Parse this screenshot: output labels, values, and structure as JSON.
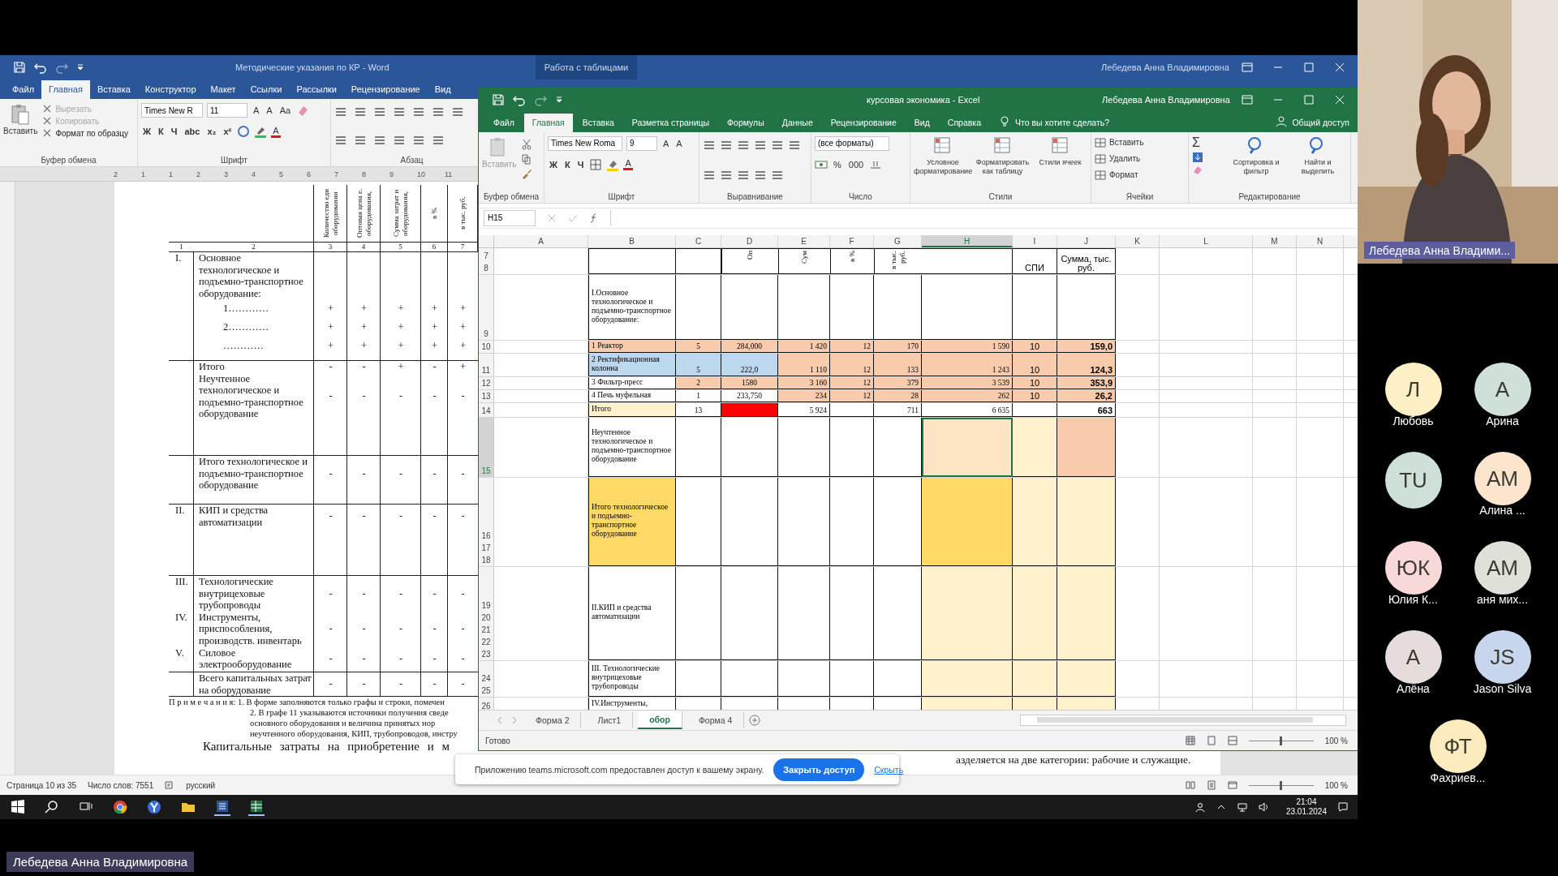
{
  "word": {
    "title": "Методические указания по КР  -  Word",
    "context_tab": "Работа с таблицами",
    "user": "Лебедева Анна Владимировна",
    "tabs": [
      {
        "label": "Файл",
        "selected": false
      },
      {
        "label": "Главная",
        "selected": true
      },
      {
        "label": "Вставка",
        "selected": false
      },
      {
        "label": "Конструктор",
        "selected": false
      },
      {
        "label": "Макет",
        "selected": false
      },
      {
        "label": "Ссылки",
        "selected": false
      },
      {
        "label": "Рассылки",
        "selected": false
      },
      {
        "label": "Рецензирование",
        "selected": false
      },
      {
        "label": "Вид",
        "selected": false
      }
    ],
    "paste": "Вставить",
    "clipboard_items": [
      {
        "label": "Вырезать",
        "disabled": true
      },
      {
        "label": "Копировать",
        "disabled": true
      },
      {
        "label": "Формат по образцу",
        "disabled": false
      }
    ],
    "font_name": "Times New R",
    "font_size": "11",
    "size_tools": [
      "A",
      "A",
      "Aa"
    ],
    "format_letters": [
      "Ж",
      "К",
      "Ч",
      "abc",
      "x₂",
      "x²"
    ],
    "font_color_letter": "A",
    "groups": [
      "Буфер обмена",
      "Шрифт",
      "Абзац"
    ],
    "ruler": [
      "2",
      "1",
      "1",
      "2",
      "3",
      "4",
      "5",
      "6",
      "7",
      "8",
      "9",
      "10",
      "11"
    ],
    "table": {
      "headers": [
        [
          "Количество еди",
          "оборудовании"
        ],
        [
          "Оптовая цена е.",
          "оборудования, "
        ],
        [
          "Сумма затрат н",
          "оборудования, "
        ],
        [
          "в %"
        ],
        [
          "в тыс. руб."
        ]
      ],
      "numbers": [
        "1",
        "2",
        "3",
        "4",
        "5",
        "6",
        "7"
      ],
      "sections": [
        {
          "rows": [
            {
              "num": "I.",
              "label": "Основное технологическое и подъемно-транспортное оборудование:"
            },
            {
              "kind": "item",
              "label": "1…………",
              "marks": [
                "+",
                "+",
                "+",
                "+",
                "+"
              ]
            },
            {
              "kind": "item",
              "label": "2…………",
              "marks": [
                "+",
                "+",
                "+",
                "+",
                "+"
              ]
            },
            {
              "kind": "item",
              "label": "…………",
              "marks": [
                "+",
                "+",
                "+",
                "+",
                "+"
              ]
            }
          ]
        },
        {
          "rows": [
            {
              "label": "Итого",
              "marks": [
                "-",
                "-",
                "+",
                "-",
                "+"
              ]
            },
            {
              "label": "Неучтенное технологическое и подъемно-транспортное оборудование",
              "marks": [
                "-",
                "-",
                "-",
                "-",
                "-"
              ]
            }
          ]
        },
        {
          "rows": [
            {
              "label": "Итого технологическое и подъемно-транспортное оборудование",
              "marks": [
                "-",
                "-",
                "-",
                "-",
                "-"
              ]
            }
          ]
        },
        {
          "rows": [
            {
              "num": "II.",
              "label": "КИП и средства автоматизации",
              "marks": [
                "-",
                "-",
                "-",
                "-",
                "-"
              ]
            }
          ]
        },
        {
          "rows": [
            {
              "num": "III.",
              "label": "Технологические внутрицеховые трубопроводы",
              "marks": [
                "-",
                "-",
                "-",
                "-",
                "-"
              ]
            },
            {
              "num": "IV.",
              "label": "Инструменты, приспособления, производств. инвентарь",
              "marks": [
                "-",
                "-",
                "-",
                "-",
                "-"
              ]
            },
            {
              "num": "V.",
              "label": "Силовое электрооборудование",
              "marks": [
                "-",
                "-",
                "-",
                "-",
                "-"
              ]
            }
          ]
        },
        {
          "rows": [
            {
              "label": "Всего капитальных затрат на оборудование",
              "marks": [
                "-",
                "-",
                "-",
                "-",
                "-"
              ]
            }
          ]
        }
      ]
    },
    "notes": [
      "П р и м е ч а н и я: 1. В форме заполняются только графы и строки, помечен",
      "2. В графе 11 указываются источники получения сведе",
      "основного оборудования и величина принятых нор",
      "неучтенного оборудования, КИП, трубопроводов, инстру"
    ],
    "heading": "Капитальные затраты на приобретение и м",
    "body_line": "азделяется на две категории: рабочие и служащие.",
    "status": {
      "page": "Страница 10 из 35",
      "words": "Число слов: 7551",
      "language": "русский",
      "zoom": "100 %",
      "zoom_slider": {
        "level": 0.5
      }
    }
  },
  "excel": {
    "title": "курсовая экономика  -  Excel",
    "user": "Лебедева Анна Владимировна",
    "tabs": [
      {
        "label": "Файл",
        "selected": false
      },
      {
        "label": "Главная",
        "selected": true
      },
      {
        "label": "Вставка",
        "selected": false
      },
      {
        "label": "Разметка страницы",
        "selected": false
      },
      {
        "label": "Формулы",
        "selected": false
      },
      {
        "label": "Данные",
        "selected": false
      },
      {
        "label": "Рецензирование",
        "selected": false
      },
      {
        "label": "Вид",
        "selected": false
      },
      {
        "label": "Справка",
        "selected": false
      }
    ],
    "tell_me": "Что вы хотите сделать?",
    "share": "Общий доступ",
    "paste": {
      "label": "Вставить",
      "disabled": true
    },
    "font_name": "Times New Roma",
    "font_size": "9",
    "size_tools": [
      "A",
      "A"
    ],
    "format_letters": [
      "Ж",
      "К",
      "Ч"
    ],
    "font_color_letter": "A",
    "number_format": "(все форматы)",
    "number_tools": [
      "%",
      "000"
    ],
    "style_buttons": [
      "Условное форматирование",
      "Форматировать как таблицу",
      "Стили ячеек"
    ],
    "cell_buttons": [
      "Вставить",
      "Удалить",
      "Формат"
    ],
    "sum_symbol": "Σ",
    "edit_buttons": [
      "Сортировка и фильтр",
      "Найти и выделить"
    ],
    "groups": [
      "Буфер обмена",
      "Шрифт",
      "Выравнивание",
      "Число",
      "Стили",
      "Ячейки",
      "Редактирование"
    ],
    "name_box": "H15",
    "columns": [
      {
        "label": "A",
        "selected": false
      },
      {
        "label": "B",
        "selected": false
      },
      {
        "label": "C",
        "selected": false
      },
      {
        "label": "D",
        "selected": false
      },
      {
        "label": "E",
        "selected": false
      },
      {
        "label": "F",
        "selected": false
      },
      {
        "label": "G",
        "selected": false
      },
      {
        "label": "H",
        "selected": true
      },
      {
        "label": "I",
        "selected": false
      },
      {
        "label": "J",
        "selected": false
      },
      {
        "label": "K",
        "selected": false
      },
      {
        "label": "L",
        "selected": false
      },
      {
        "label": "M",
        "selected": false
      },
      {
        "label": "N",
        "selected": false
      }
    ],
    "blocks": [
      {
        "rows": [
          {
            "label": "7",
            "selected": false
          },
          {
            "label": "8",
            "selected": false
          }
        ],
        "cells": [
          {},
          {},
          {
            "text": "Оп",
            "kind": "rotated"
          },
          {
            "text": "Сум",
            "kind": "rotated"
          },
          {
            "text": "в %",
            "kind": "rotated"
          },
          {
            "text": "в тыс. руб.",
            "kind": "rotated"
          },
          {},
          {
            "text": "СПИ"
          },
          {
            "text": "Сумма, тыс. руб."
          }
        ]
      },
      {
        "rows": [
          {
            "label": "9",
            "selected": false
          }
        ],
        "cells": [
          {
            "text": "I.Основное технологическое и подъемно-транспортное оборудование:"
          },
          {},
          {},
          {},
          {},
          {},
          {},
          {},
          {}
        ]
      },
      {
        "rows": [
          {
            "label": "10",
            "selected": false
          }
        ],
        "cells": [
          {
            "text": "1 Реактор",
            "color": "#f8cbad"
          },
          {
            "text": "5",
            "color": "#f8cbad"
          },
          {
            "text": "284,000",
            "color": "#f8cbad"
          },
          {
            "text": "1 420",
            "color": "#f8cbad"
          },
          {
            "text": "12",
            "color": "#f8cbad"
          },
          {
            "text": "170",
            "color": "#f8cbad"
          },
          {
            "text": "1 590",
            "color": "#f8cbad"
          },
          {
            "text": "10",
            "color": "#f8cbad"
          },
          {
            "text": "159,0",
            "color": "#f8cbad"
          }
        ]
      },
      {
        "rows": [
          {
            "label": "11",
            "selected": false
          }
        ],
        "cells": [
          {
            "text": "2 Ректификационная колонна",
            "color": "#bdd7ee"
          },
          {
            "text": "5",
            "color": "#bdd7ee"
          },
          {
            "text": "222,0",
            "color": "#bdd7ee"
          },
          {
            "text": "1 110",
            "color": "#f8cbad"
          },
          {
            "text": "12",
            "color": "#f8cbad"
          },
          {
            "text": "133",
            "color": "#f8cbad"
          },
          {
            "text": "1 243",
            "color": "#f8cbad"
          },
          {
            "text": "10",
            "color": "#f8cbad"
          },
          {
            "text": "124,3",
            "color": "#f8cbad"
          }
        ]
      },
      {
        "rows": [
          {
            "label": "12",
            "selected": false
          }
        ],
        "cells": [
          {
            "text": "3 Фильтр-пресс"
          },
          {
            "text": "2",
            "color": "#f8cbad"
          },
          {
            "text": "1580",
            "color": "#f8cbad"
          },
          {
            "text": "3 160",
            "color": "#f8cbad"
          },
          {
            "text": "12",
            "color": "#f8cbad"
          },
          {
            "text": "379",
            "color": "#f8cbad"
          },
          {
            "text": "3 539",
            "color": "#f8cbad"
          },
          {
            "text": "10",
            "color": "#f8cbad"
          },
          {
            "text": "353,9",
            "color": "#f8cbad"
          }
        ]
      },
      {
        "rows": [
          {
            "label": "13",
            "selected": false
          }
        ],
        "cells": [
          {
            "text": "4 Печь муфельная"
          },
          {
            "text": "1"
          },
          {
            "text": "233,750"
          },
          {
            "text": "234",
            "color": "#f8cbad"
          },
          {
            "text": "12",
            "color": "#f8cbad"
          },
          {
            "text": "28",
            "color": "#f8cbad"
          },
          {
            "text": "262",
            "color": "#f8cbad"
          },
          {
            "text": "10",
            "color": "#f8cbad"
          },
          {
            "text": "26,2",
            "color": "#f8cbad"
          }
        ]
      },
      {
        "rows": [
          {
            "label": "14",
            "selected": false
          }
        ],
        "cells": [
          {
            "text": "Итого",
            "color": "#fff2cc"
          },
          {
            "text": "13"
          },
          {
            "color": "#ff0000"
          },
          {
            "text": "5 924"
          },
          {},
          {
            "text": "711"
          },
          {
            "text": "6 635"
          },
          {},
          {
            "text": "663"
          }
        ]
      },
      {
        "rows": [
          {
            "label": "15",
            "selected": true
          }
        ],
        "cells": [
          {
            "text": "Неучтенное технологическое и подъемно-транспортное оборудование"
          },
          {},
          {},
          {},
          {},
          {},
          {
            "color": "#fce4c4"
          },
          {
            "color": "#fff2cc"
          },
          {
            "color": "#f8cbad"
          }
        ]
      },
      {
        "rows": [
          {
            "label": "16",
            "selected": false
          },
          {
            "label": "17",
            "selected": false
          },
          {
            "label": "18",
            "selected": false
          }
        ],
        "cells": [
          {
            "text": "Итого технологическое и подъемно-транспортное оборудование",
            "color": "#ffd966"
          },
          {},
          {},
          {},
          {},
          {},
          {
            "color": "#ffd966"
          },
          {
            "color": "#fff2cc"
          },
          {
            "color": "#fff2cc"
          }
        ]
      },
      {
        "rows": [
          {
            "label": "19",
            "selected": false
          },
          {
            "label": "20",
            "selected": false
          },
          {
            "label": "21",
            "selected": false
          },
          {
            "label": "22",
            "selected": false
          },
          {
            "label": "23",
            "selected": false
          }
        ],
        "cells": [
          {
            "text": "II.КИП и средства автоматизации"
          },
          {},
          {},
          {},
          {},
          {},
          {
            "color": "#fff2cc"
          },
          {
            "color": "#fff2cc"
          },
          {
            "color": "#fff2cc"
          }
        ]
      },
      {
        "rows": [
          {
            "label": "24",
            "selected": false
          },
          {
            "label": "25",
            "selected": false
          }
        ],
        "cells": [
          {
            "text": "III. Технологические внутрицеховые трубопроводы"
          },
          {},
          {},
          {},
          {},
          {},
          {
            "color": "#fff2cc"
          },
          {
            "color": "#fff2cc"
          },
          {
            "color": "#fff2cc"
          }
        ]
      },
      {
        "rows": [
          {
            "label": "26",
            "selected": false
          }
        ],
        "cells": [
          {
            "text": "IV.Инструменты,"
          },
          {},
          {},
          {},
          {},
          {},
          {
            "color": "#fff2cc"
          },
          {
            "color": "#fff2cc"
          },
          {
            "color": "#fff2cc"
          }
        ]
      }
    ],
    "sheets": [
      {
        "label": "Форма 2",
        "selected": false
      },
      {
        "label": "Лист1",
        "selected": false
      },
      {
        "label": "обор",
        "selected": true
      },
      {
        "label": "Форма 4",
        "selected": false
      }
    ],
    "status": "Готово",
    "zoom": "100 %",
    "zoom_slider": {
      "level": 0.5
    }
  },
  "notification": {
    "text": "Приложению teams.microsoft.com предоставлен доступ к вашему экрану.",
    "button": "Закрыть доступ",
    "link": "Скрыть"
  },
  "taskbar": {
    "time": "21:04",
    "date": "23.01.2024"
  },
  "call": {
    "presenter": "Лебедева Анна Владими...",
    "bottom_name": "Лебедева Анна Владимировна",
    "participants": [
      {
        "initials": "Л",
        "name": "Любовь",
        "color": "#fdf0c4"
      },
      {
        "initials": "А",
        "name": "Арина",
        "color": "#cfe0d8"
      },
      {
        "initials": "TU",
        "color": "#cfe0d8"
      },
      {
        "initials": "АМ",
        "name": "Алина ...",
        "color": "#fde4cc"
      },
      {
        "initials": "ЮК",
        "name": "Юлия К...",
        "color": "#f9d9d7"
      },
      {
        "initials": "АМ",
        "name": "аня мих...",
        "color": "#dfe0d8"
      },
      {
        "initials": "А",
        "name": "Алёна",
        "color": "#e6dcdc"
      },
      {
        "initials": "JS",
        "name": "Jason Silva",
        "color": "#c7d6ec"
      },
      {
        "initials": "ФТ",
        "name": "Фахриев...",
        "color": "#fdebc0"
      }
    ]
  }
}
